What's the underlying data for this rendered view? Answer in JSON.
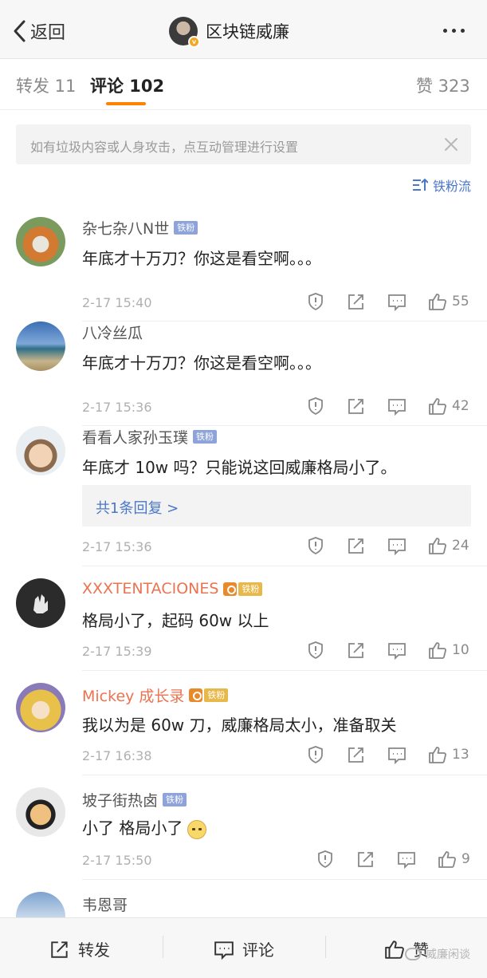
{
  "header": {
    "back_label": "返回",
    "title": "区块链威廉",
    "verified_mark": "v"
  },
  "tabs": {
    "repost": "转发 11",
    "comment": "评论 102",
    "like": "赞 323"
  },
  "notice": {
    "text": "如有垃圾内容或人身攻击，点互动管理进行设置"
  },
  "sort": {
    "label": "铁粉流"
  },
  "comments": [
    {
      "name": "杂七杂八N世",
      "badge": "铁粉",
      "text": "年底才十万刀？你这是看空啊。。。",
      "time": "2-17 15:40",
      "likes": "55"
    },
    {
      "name": "八冷丝瓜",
      "text": "年底才十万刀？你这是看空啊。。。",
      "time": "2-17 15:36",
      "likes": "42"
    },
    {
      "name": "看看人家孙玉璞",
      "badge": "铁粉",
      "text": "年底才 10w 吗？只能说这回威廉格局小了。",
      "reply": "共1条回复 >",
      "time": "2-17 15:36",
      "likes": "24"
    },
    {
      "name": "XXXTENTACIONES",
      "badge": "铁粉",
      "text": "格局小了，起码 60w 以上",
      "time": "2-17 15:39",
      "likes": "10"
    },
    {
      "name": "Mickey 成长录",
      "badge": "铁粉",
      "text": "我以为是 60w 刀，威廉格局太小，准备取关",
      "time": "2-17 16:38",
      "likes": "13"
    },
    {
      "name": "坡子街热卤",
      "badge": "铁粉",
      "text": "小了 格局小了",
      "time": "2-17 15:50",
      "likes": "9"
    },
    {
      "name": "韦恩哥"
    }
  ],
  "bottom_bar": {
    "repost": "转发",
    "comment": "评论",
    "like": "赞"
  },
  "watermark": "威廉闲谈",
  "colors": {
    "accent": "#ff8200",
    "link": "#4a77c8",
    "vip_name": "#eb7350",
    "fan_badge": "#8ea3d9"
  }
}
